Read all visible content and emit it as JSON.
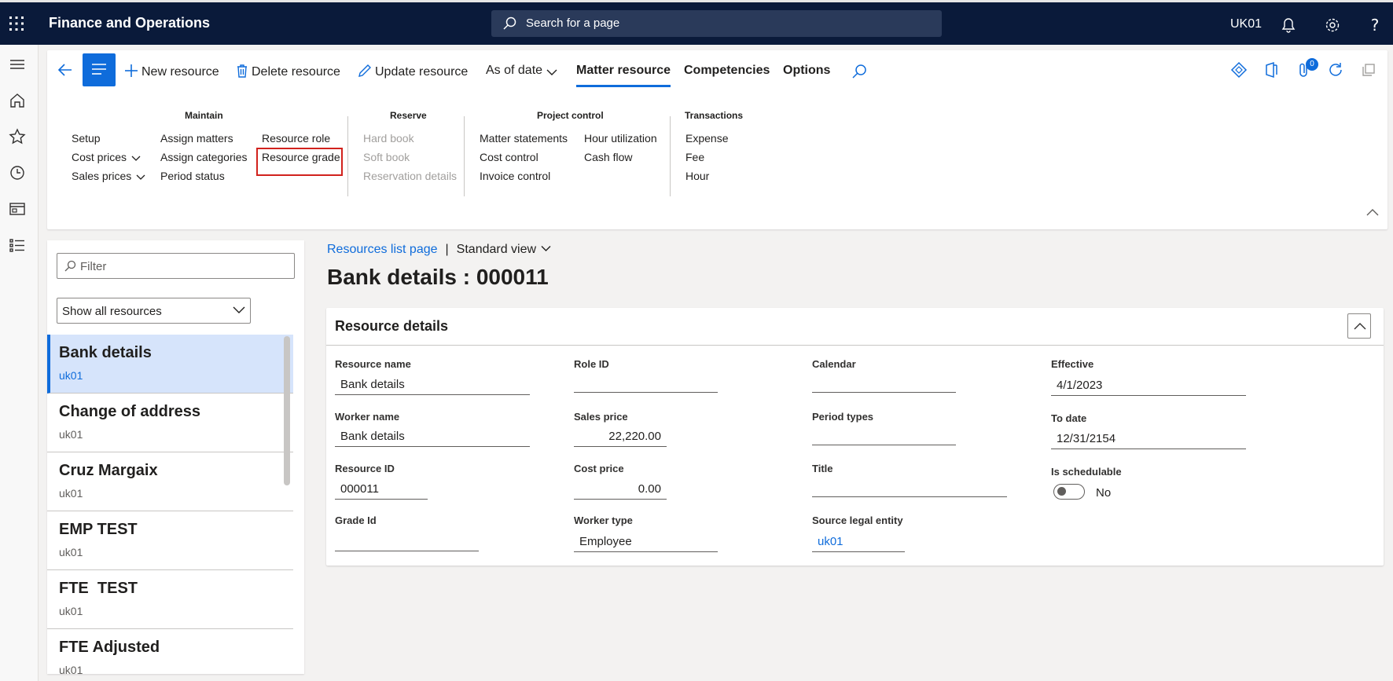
{
  "topbar": {
    "app_title": "Finance and Operations",
    "search_placeholder": "Search for a page",
    "company": "UK01",
    "icons": [
      "waffle-icon",
      "search-icon",
      "bell-icon",
      "gear-icon",
      "help-icon"
    ]
  },
  "rail": {
    "icons": [
      "hamburger-icon",
      "home-icon",
      "star-icon",
      "clock-icon",
      "workspace-icon",
      "list-icon"
    ]
  },
  "action_pane": {
    "new_resource": "New resource",
    "delete_resource": "Delete resource",
    "update_resource": "Update resource",
    "as_of_date": "As of date",
    "tabs": {
      "matter_resource": "Matter resource",
      "competencies": "Competencies",
      "options": "Options"
    },
    "badge_count": "0",
    "groups": {
      "maintain": {
        "title": "Maintain",
        "col1": [
          "Setup",
          "Cost prices",
          "Sales prices"
        ],
        "col2": [
          "Assign matters",
          "Assign categories",
          "Period status"
        ],
        "col3": [
          "Resource role",
          "Resource grade"
        ]
      },
      "reserve": {
        "title": "Reserve",
        "items": [
          "Hard book",
          "Soft book",
          "Reservation details"
        ]
      },
      "project_control": {
        "title": "Project control",
        "col1": [
          "Matter statements",
          "Cost control",
          "Invoice control"
        ],
        "col2": [
          "Hour utilization",
          "Cash flow"
        ]
      },
      "transactions": {
        "title": "Transactions",
        "items": [
          "Expense",
          "Fee",
          "Hour"
        ]
      }
    }
  },
  "list_panel": {
    "filter_placeholder": "Filter",
    "dropdown_value": "Show all resources",
    "items": [
      {
        "name": "Bank details",
        "sub": "uk01"
      },
      {
        "name": "Change of address",
        "sub": "uk01"
      },
      {
        "name": "Cruz Margaix",
        "sub": "uk01"
      },
      {
        "name": "EMP TEST",
        "sub": "uk01"
      },
      {
        "name": "FTE  TEST",
        "sub": "uk01"
      },
      {
        "name": "FTE Adjusted",
        "sub": "uk01"
      }
    ]
  },
  "breadcrumb": {
    "link": "Resources list page",
    "separator": "|",
    "view": "Standard view"
  },
  "page_title": "Bank details : 000011",
  "card": {
    "title": "Resource details",
    "fields": {
      "resource_name": {
        "label": "Resource name",
        "value": "Bank details"
      },
      "worker_name": {
        "label": "Worker name",
        "value": "Bank details"
      },
      "resource_id": {
        "label": "Resource ID",
        "value": "000011"
      },
      "grade_id": {
        "label": "Grade Id",
        "value": ""
      },
      "role_id": {
        "label": "Role ID",
        "value": ""
      },
      "sales_price": {
        "label": "Sales price",
        "value": "22,220.00"
      },
      "cost_price": {
        "label": "Cost price",
        "value": "0.00"
      },
      "worker_type": {
        "label": "Worker type",
        "value": "Employee"
      },
      "calendar": {
        "label": "Calendar",
        "value": ""
      },
      "period_types": {
        "label": "Period types",
        "value": ""
      },
      "title": {
        "label": "Title",
        "value": ""
      },
      "source_legal_entity": {
        "label": "Source legal entity",
        "value": "uk01"
      },
      "effective": {
        "label": "Effective",
        "value": "4/1/2023"
      },
      "to_date": {
        "label": "To date",
        "value": "12/31/2154"
      },
      "is_schedulable": {
        "label": "Is schedulable",
        "value": "No"
      }
    }
  },
  "colors": {
    "nav_bg": "#0a1a3a",
    "accent": "#0f6cdb",
    "highlight": "#d1221d"
  }
}
